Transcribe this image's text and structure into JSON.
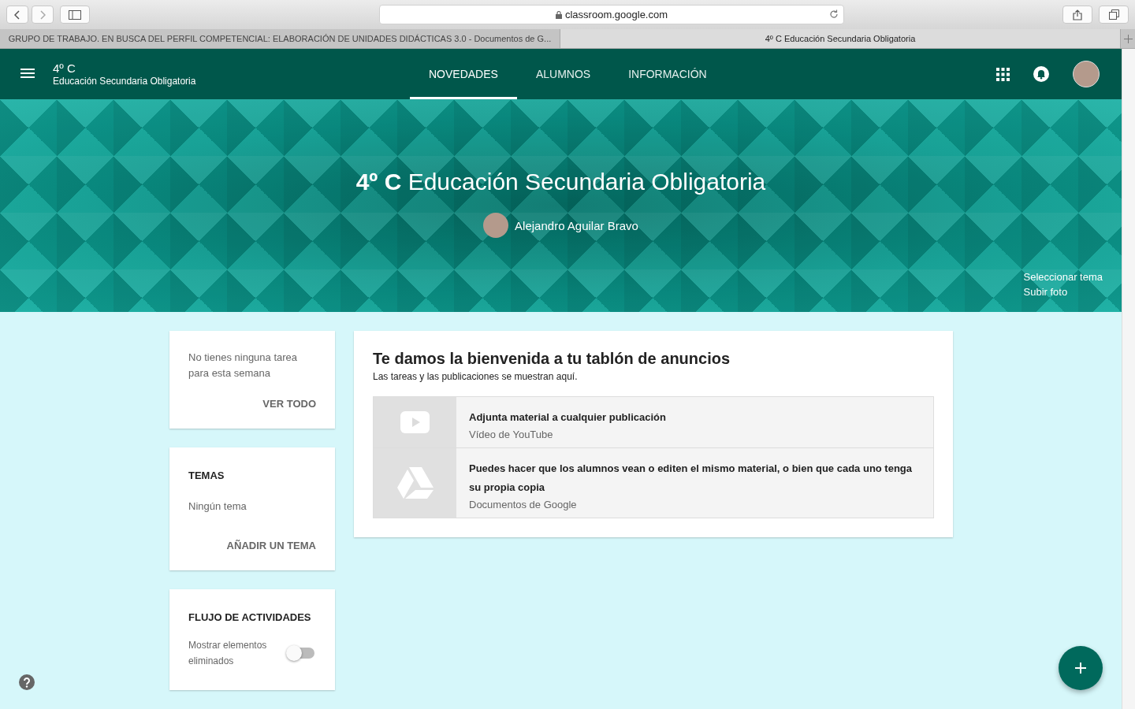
{
  "browser": {
    "url": "classroom.google.com",
    "tabs": [
      {
        "title": "GRUPO DE TRABAJO. EN BUSCA DEL PERFIL COMPETENCIAL: ELABORACIÓN DE UNIDADES DIDÁCTICAS 3.0 - Documentos de G...",
        "selected": false
      },
      {
        "title": "4º C Educación Secundaria Obligatoria",
        "selected": true
      }
    ]
  },
  "header": {
    "class_name": "4º C",
    "section": "Educación Secundaria Obligatoria",
    "tabs": [
      {
        "label": "NOVEDADES",
        "selected": true
      },
      {
        "label": "ALUMNOS",
        "selected": false
      },
      {
        "label": "INFORMACIÓN",
        "selected": false
      }
    ]
  },
  "banner": {
    "title": "**4º C** Educación Secundaria Obligatoria",
    "teacher": "Alejandro Aguilar Bravo",
    "links": [
      "Seleccionar tema",
      "Subir foto"
    ]
  },
  "upcoming": {
    "text": "No tienes ninguna tarea para esta semana",
    "link": "VER TODO"
  },
  "topics": {
    "title": "TEMAS",
    "empty": "Ningún tema",
    "link": "AÑADIR UN TEMA"
  },
  "activity": {
    "title": "FLUJO DE ACTIVIDADES",
    "label": "Mostrar elementos eliminados",
    "on": false
  },
  "welcome": {
    "title": "Te damos la bienvenida a tu tablón de anuncios",
    "subtitle": "Las tareas y las publicaciones se muestran aquí.",
    "items": [
      {
        "kind": "youtube",
        "title": "Adjunta material a cualquier publicación",
        "subtitle": "Vídeo de YouTube"
      },
      {
        "kind": "drive",
        "title": "Puedes hacer que los alumnos vean o editen el mismo material, o bien que cada uno tenga su propia copia",
        "subtitle": "Documentos de Google"
      }
    ]
  }
}
